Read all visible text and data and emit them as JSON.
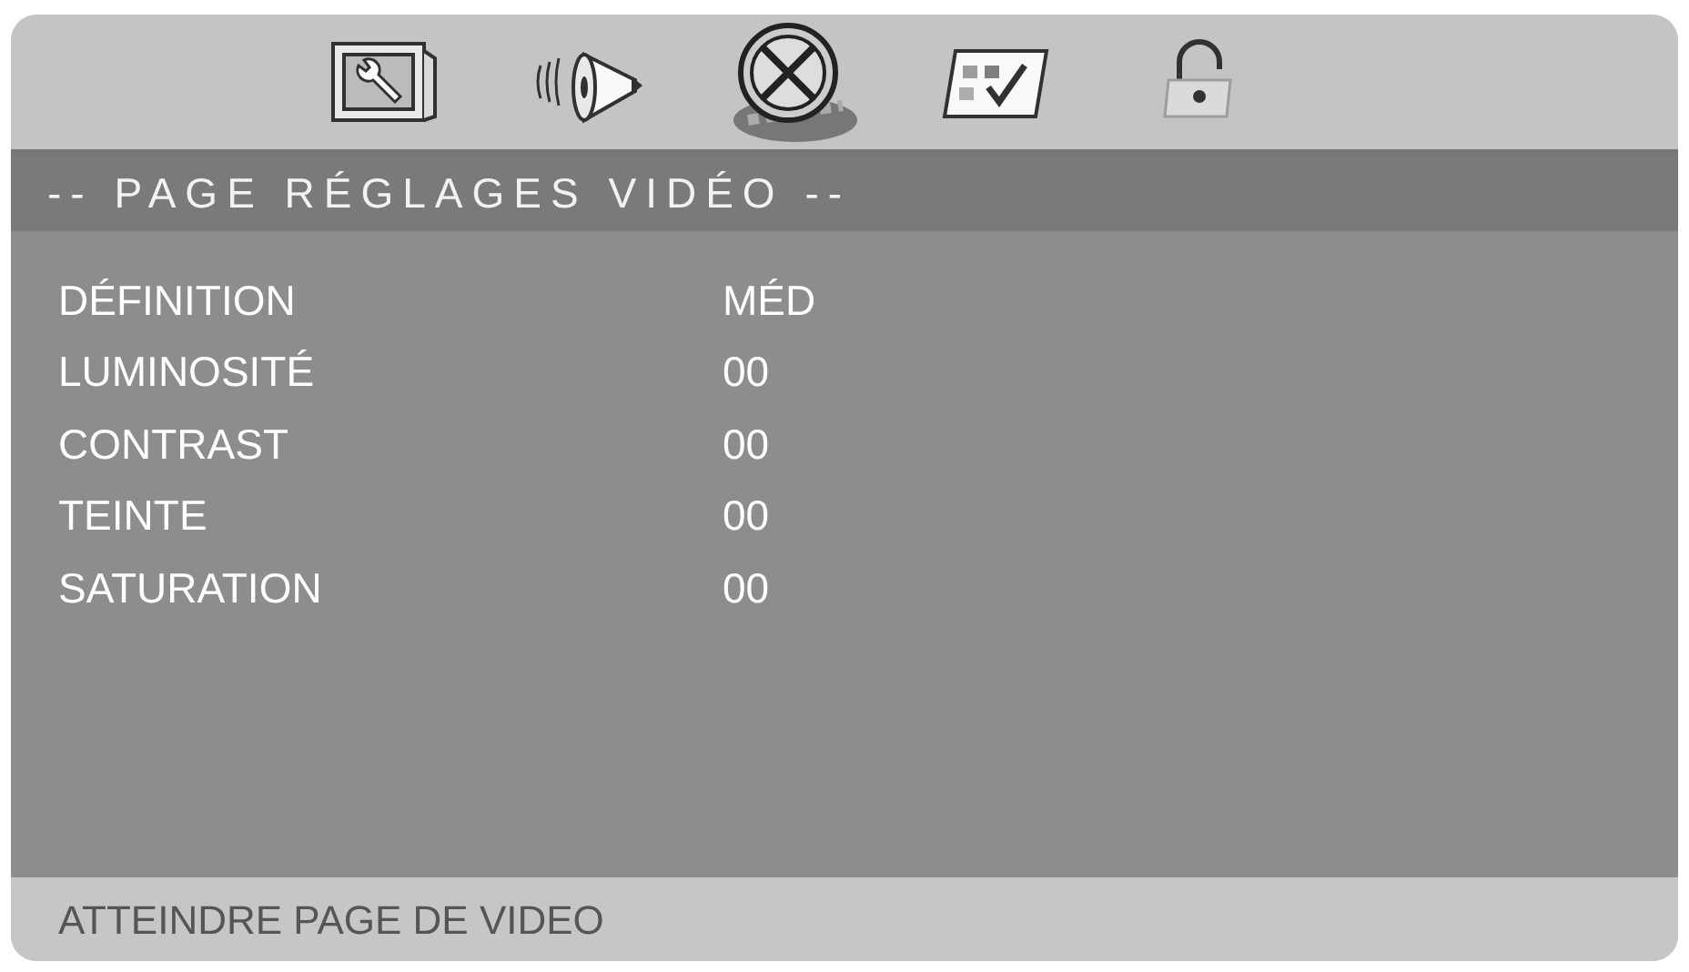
{
  "tabs": [
    {
      "kind": "setup",
      "selected": false
    },
    {
      "kind": "audio",
      "selected": false
    },
    {
      "kind": "video",
      "selected": true
    },
    {
      "kind": "preference",
      "selected": false
    },
    {
      "kind": "lock",
      "selected": false
    }
  ],
  "page_title": "-- PAGE RÉGLAGES VIDÉO --",
  "settings": [
    {
      "label": "DÉFINITION",
      "value": "MÉD"
    },
    {
      "label": "LUMINOSITÉ",
      "value": "00"
    },
    {
      "label": "CONTRAST",
      "value": "00"
    },
    {
      "label": "TEINTE",
      "value": "00"
    },
    {
      "label": "SATURATION",
      "value": "00"
    }
  ],
  "status_bar": "ATTEINDRE PAGE DE VIDEO"
}
